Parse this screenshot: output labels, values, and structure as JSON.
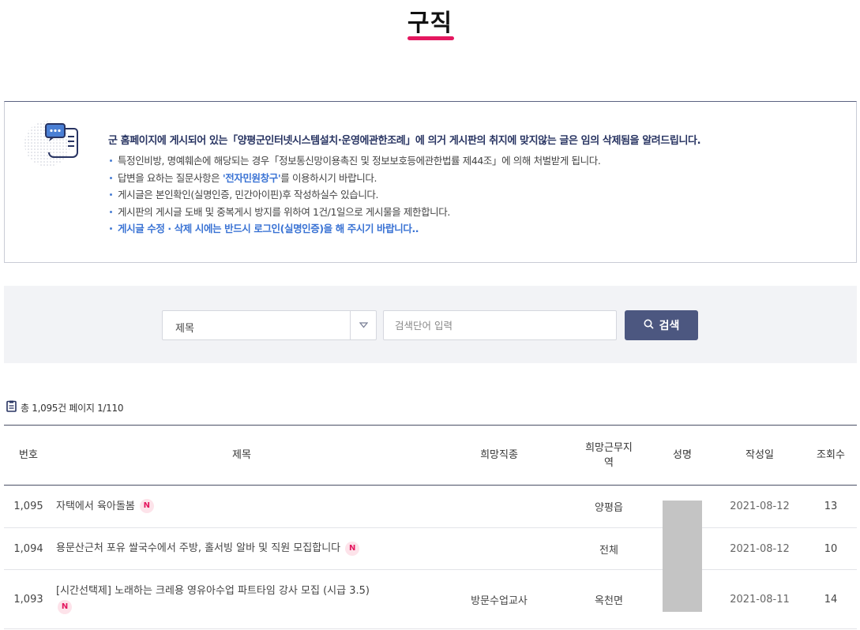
{
  "page": {
    "title": "구직"
  },
  "notice": {
    "lead": "군 홈페이지에 게시되어 있는「양평군인터넷시스템설치·운영에관한조례」에 의거 게시판의 취지에 맞지않는 글은 임의 삭제됨을 알려드립니다.",
    "items": [
      "특정인비방, 명예훼손에 해당되는 경우「정보통신망이용촉진 및 정보보호등에관한법률 제44조」에 의해 처벌받게 됩니다.",
      "게시글은 본인확인(실명인증, 민간아이핀)후 작성하실수 있습니다.",
      "게시판의 게시글 도배 및 중복게시 방지를 위하여 1건/1일으로 게시물을 제한합니다.",
      "게시글 수정 · 삭제 시에는 반드시 로그인(실명인증)을 해 주시기 바랍니다.."
    ],
    "item2": {
      "before": "답변을 요하는 질문사항은 ",
      "link": "'전자민원창구'",
      "after": "를 이용하시기 바랍니다."
    }
  },
  "search": {
    "select_value": "제목",
    "placeholder": "검색단어 입력",
    "button_label": "검색"
  },
  "summary": {
    "text": "총 1,095건  페이지 1/110"
  },
  "table": {
    "headers": {
      "no": "번호",
      "subject": "제목",
      "job": "희망직종",
      "area": "희망근무지역",
      "name": "성명",
      "date": "작성일",
      "views": "조회수"
    },
    "new_badge": "N",
    "rows": [
      {
        "no": "1,095",
        "subject": "자택에서 육아돌봄",
        "job": "",
        "area": "양평읍",
        "date": "2021-08-12",
        "views": "13"
      },
      {
        "no": "1,094",
        "subject": "용문산근처 포유 쌀국수에서 주방, 홀서빙 알바 및 직원 모집합니다",
        "job": "",
        "area": "전체",
        "date": "2021-08-12",
        "views": "10"
      },
      {
        "no": "1,093",
        "subject": "[시간선택제] 노래하는 크레용 영유아수업 파트타임 강사 모집 (시급 3.5)",
        "job": "방문수업교사",
        "area": "옥천면",
        "date": "2021-08-11",
        "views": "14"
      }
    ]
  }
}
